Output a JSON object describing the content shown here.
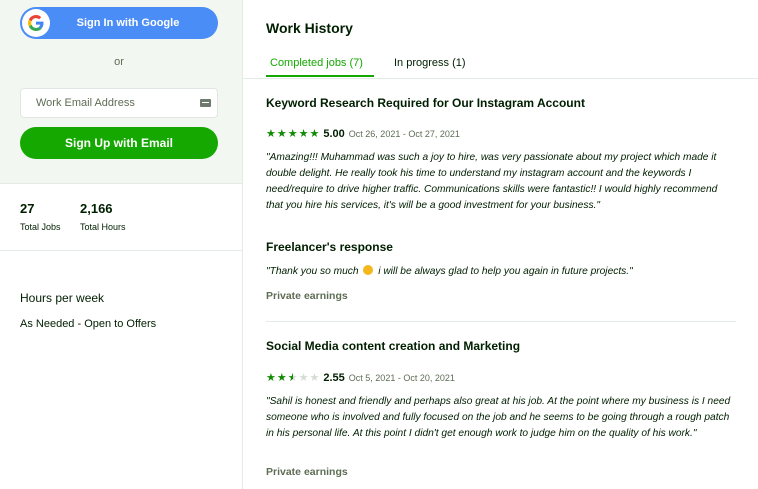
{
  "auth": {
    "google_label": "Sign In with Google",
    "or_label": "or",
    "email_placeholder": "Work Email Address",
    "signup_label": "Sign Up with Email"
  },
  "stats": {
    "jobs_value": "27",
    "jobs_label": "Total Jobs",
    "hours_value": "2,166",
    "hours_label": "Total Hours"
  },
  "availability": {
    "title": "Hours per week",
    "value": "As Needed - Open to Offers"
  },
  "work_history": {
    "title": "Work History",
    "tabs": [
      {
        "label": "Completed jobs (7)",
        "active": true
      },
      {
        "label": "In progress (1)",
        "active": false
      }
    ],
    "jobs": [
      {
        "title": "Keyword Research Required for Our Instagram Account",
        "rating": 5.0,
        "score": "5.00",
        "dates": "Oct 26, 2021 - Oct 27, 2021",
        "review": "\"Amazing!!! Muhammad was such a joy to hire, was very passionate about my project which made it double delight. He really took his time to understand my instagram account and the keywords I need/require to drive higher traffic. Communications skills were fantastic!! I would highly recommend that you hire his services, it's will be a good investment for your business.\"",
        "response_title": "Freelancer's response",
        "response_text_before": "\"Thank you so much",
        "response_text_after": "i will be always glad to help you again in future projects.\"",
        "earnings": "Private earnings"
      },
      {
        "title": "Social Media content creation and Marketing",
        "rating": 2.55,
        "score": "2.55",
        "dates": "Oct 5, 2021 - Oct 20, 2021",
        "review": "\"Sahil is honest and friendly and perhaps also great at his job. At the point where my business is I need someone who is involved and fully focused on the job and he seems to be going through a rough patch in his personal life. At this point I didn't get enough work to judge him on the quality of his work.\"",
        "earnings": "Private earnings"
      }
    ]
  },
  "colors": {
    "brand_green": "#14a800",
    "star_green": "#108a00",
    "google_blue": "#4b8df7",
    "sidebar_bg": "#f2f7f2"
  },
  "icons": [
    "google-logo-icon",
    "keyboard-icon",
    "star-icon",
    "smiling-face-emoji-icon"
  ]
}
